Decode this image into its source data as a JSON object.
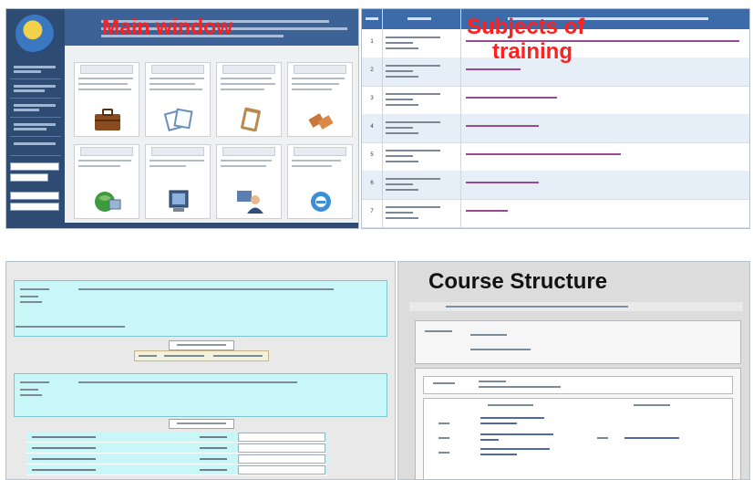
{
  "labels": {
    "main_window": "Main window",
    "subjects_line1": "Subjects of",
    "subjects_line2": "training",
    "course_structure": "Course Structure"
  },
  "colors": {
    "label_red": "#ff1f1f",
    "label_dark": "#111111",
    "sidebar_blue": "#2d4b73",
    "table_header_blue": "#3d6aa8",
    "form_cyan": "#c9f7f7"
  },
  "main_window": {
    "tiles": [
      {
        "icon": "briefcase-icon"
      },
      {
        "icon": "documents-icon"
      },
      {
        "icon": "clipboard-icon"
      },
      {
        "icon": "folders-icon"
      },
      {
        "icon": "globe-computer-icon"
      },
      {
        "icon": "monitor-icon"
      },
      {
        "icon": "user-computer-icon"
      },
      {
        "icon": "internet-explorer-icon"
      }
    ]
  },
  "subjects_table": {
    "row_numbers": [
      "1",
      "2",
      "3",
      "4",
      "5",
      "6",
      "7"
    ]
  }
}
